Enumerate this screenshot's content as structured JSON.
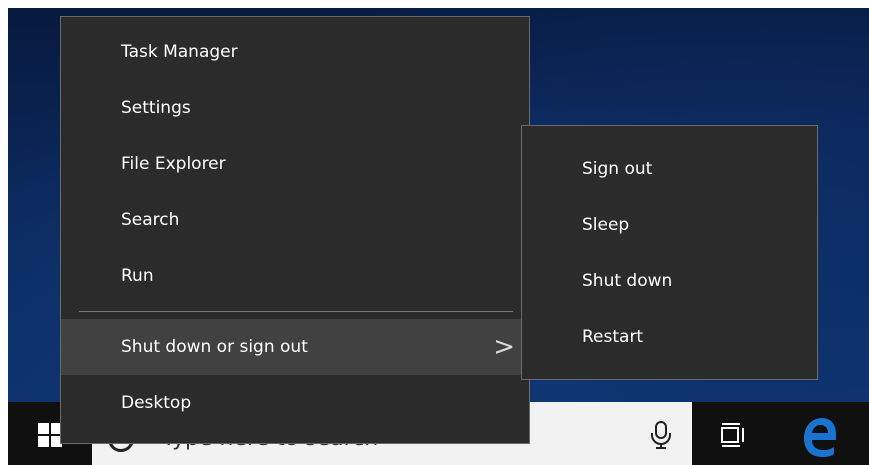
{
  "menu": {
    "items": [
      {
        "label": "Task Manager"
      },
      {
        "label": "Settings"
      },
      {
        "label": "File Explorer"
      },
      {
        "label": "Search"
      },
      {
        "label": "Run"
      }
    ],
    "shutdown_label": "Shut down or sign out",
    "desktop_label": "Desktop",
    "submenu_arrow": ">"
  },
  "submenu": {
    "items": [
      {
        "label": "Sign out"
      },
      {
        "label": "Sleep"
      },
      {
        "label": "Shut down"
      },
      {
        "label": "Restart"
      }
    ]
  },
  "taskbar": {
    "search_placeholder": "Type here to search",
    "icons": [
      "windows-logo-icon",
      "search-circle-icon",
      "microphone-icon",
      "task-view-icon",
      "edge-icon"
    ]
  },
  "colors": {
    "menu_bg": "#2b2b2b",
    "menu_hover": "#414141",
    "taskbar": "#101010",
    "edge_blue": "#1a73d1"
  }
}
